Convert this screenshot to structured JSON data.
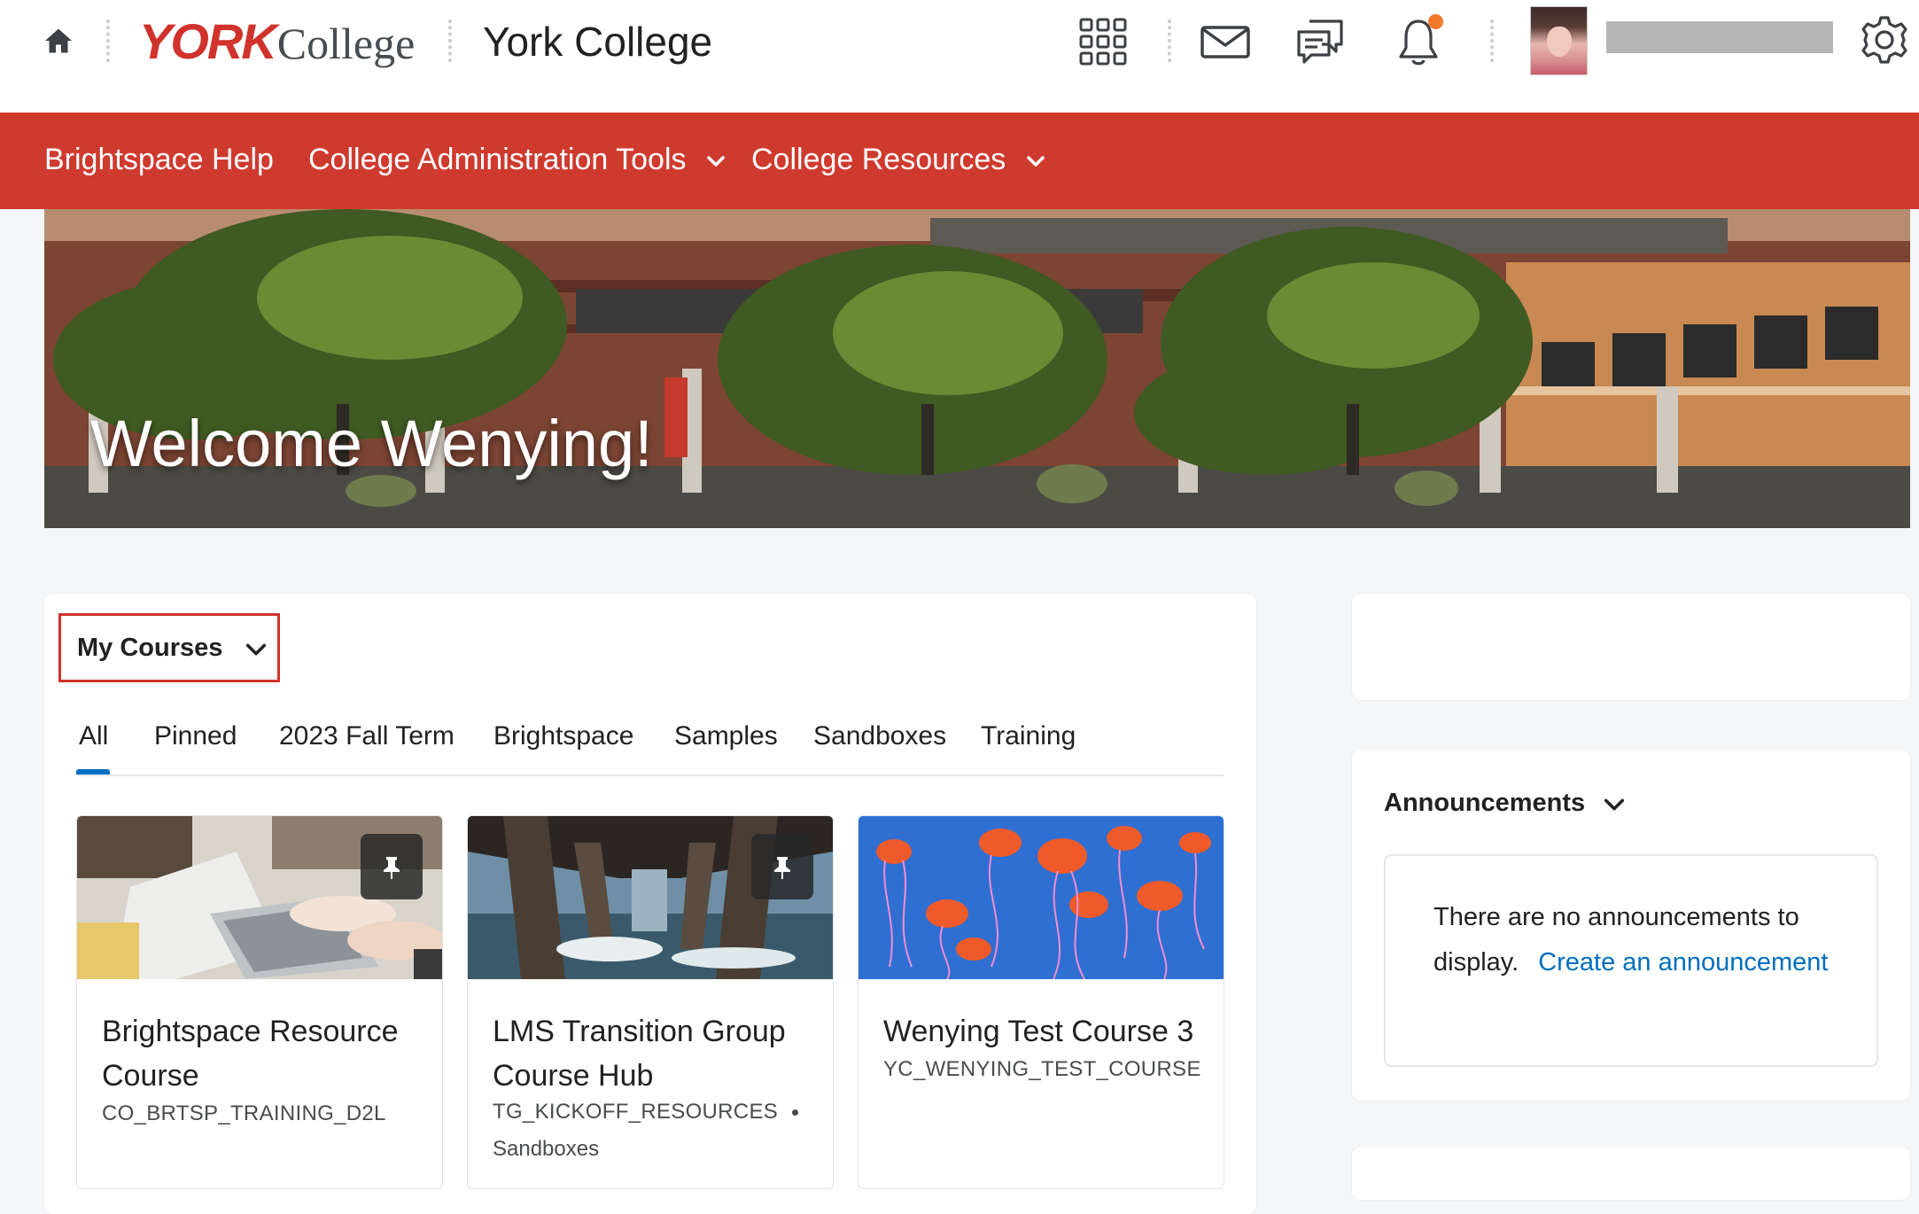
{
  "header": {
    "logo_york": "YORK",
    "logo_college": "College",
    "org_title": "York College",
    "icons": [
      "home-icon",
      "waffle-grid-icon",
      "mail-icon",
      "chat-icon",
      "bell-icon",
      "gear-icon"
    ],
    "notification_dot_color": "#f1792b"
  },
  "navbar": {
    "color": "#cf3a2f",
    "items": [
      {
        "label": "Brightspace Help",
        "has_dropdown": false
      },
      {
        "label": "College Administration Tools",
        "has_dropdown": true
      },
      {
        "label": "College Resources",
        "has_dropdown": true
      }
    ]
  },
  "hero": {
    "welcome_text": "Welcome Wenying!"
  },
  "my_courses": {
    "heading": "My Courses",
    "tabs": [
      "All",
      "Pinned",
      "2023 Fall Term",
      "Brightspace",
      "Samples",
      "Sandboxes",
      "Training"
    ],
    "active_tab": "All",
    "courses": [
      {
        "name": "Brightspace Resource Course",
        "code": "CO_BRTSP_TRAINING_D2L",
        "dept": "",
        "pinned": true
      },
      {
        "name": "LMS Transition Group Course Hub",
        "code": "TG_KICKOFF_RESOURCES",
        "dept": "Sandboxes",
        "pinned": true
      },
      {
        "name": "Wenying Test Course 3",
        "code": "YC_WENYING_TEST_COURSE:",
        "dept": "",
        "pinned": false
      }
    ]
  },
  "announcements": {
    "heading": "Announcements",
    "empty_text": "There are no announcements to display.",
    "create_link": "Create an announcement"
  },
  "colors": {
    "brand_red": "#d0332c",
    "link_blue": "#006fbf"
  }
}
